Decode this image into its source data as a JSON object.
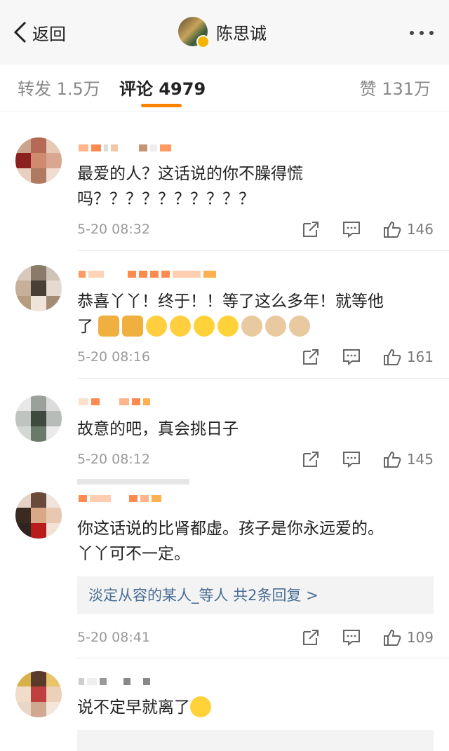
{
  "header": {
    "back_label": "返回",
    "title": "陈思诚"
  },
  "tabs": [
    {
      "label": "转发 1.5万"
    },
    {
      "label": "评论 4979"
    },
    {
      "label": "赞 131万"
    }
  ],
  "comments": [
    {
      "line1": "最爱的人？这话说的你不臊得慌",
      "line2": "吗？？？？？？？？？？",
      "time": "5-20 08:32",
      "likes": "146"
    },
    {
      "line1": "恭喜丫丫！终于！！等了这么多年！就等他",
      "line2": "了",
      "emojis": [
        "pray",
        "pray",
        "blush-heart",
        "blush-heart",
        "tongue",
        "tongue",
        "cat",
        "cat",
        "cat"
      ],
      "time": "5-20 08:16",
      "likes": "161"
    },
    {
      "line1": "故意的吧，真会挑日子",
      "time": "5-20 08:12",
      "likes": "145"
    },
    {
      "line1": "你这话说的比肾都虚。孩子是你永远爱的。",
      "line2": "丫丫可不一定。",
      "reply": "淡定从容的某人_等人  共2条回复 >",
      "time": "5-20 08:41",
      "likes": "109"
    },
    {
      "line1": "说不定早就离了",
      "emojis": [
        "laugh-cry"
      ]
    }
  ]
}
